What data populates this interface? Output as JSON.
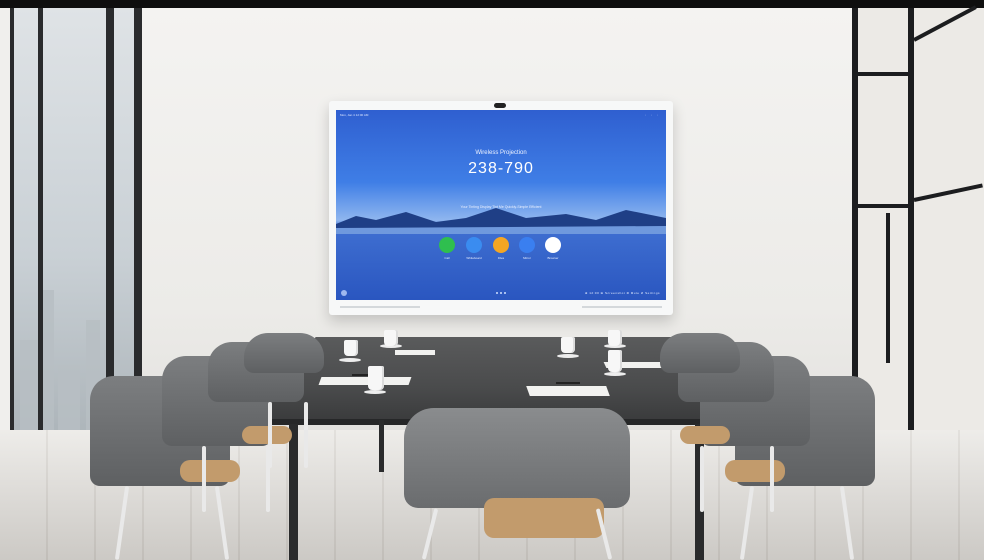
{
  "image": {
    "kind": "conference-room-photo",
    "colors": {
      "screen_blue": "#3f7ee6",
      "wall": "#f0efed",
      "chair_seat": "#c29b6c",
      "table": "#4a4b4c"
    }
  },
  "display": {
    "status_left": "Mon, Jan 4   12:00 AM",
    "status_icons": "◦ ◦ ◦",
    "projection_label": "Wireless Projection",
    "projection_code": "238-790",
    "tagline": "Your Tinting Display Tint Me Quickly-Simple Efficient",
    "apps": [
      {
        "label": "Call",
        "color": "#2fbf4f",
        "icon": "phone-icon"
      },
      {
        "label": "Whiteboard",
        "color": "#3a8cf0",
        "icon": "pen-icon"
      },
      {
        "label": "Files",
        "color": "#f5a623",
        "icon": "folder-icon"
      },
      {
        "label": "Mirror",
        "color": "#3a7ff0",
        "icon": "screen-icon"
      },
      {
        "label": "Browser",
        "color": "#ffffff",
        "icon": "globe-icon"
      }
    ],
    "bottom_right": "⊕ 12:00   ⊞ Screenshot   ⊗ Mute   ⊘ Settings"
  }
}
